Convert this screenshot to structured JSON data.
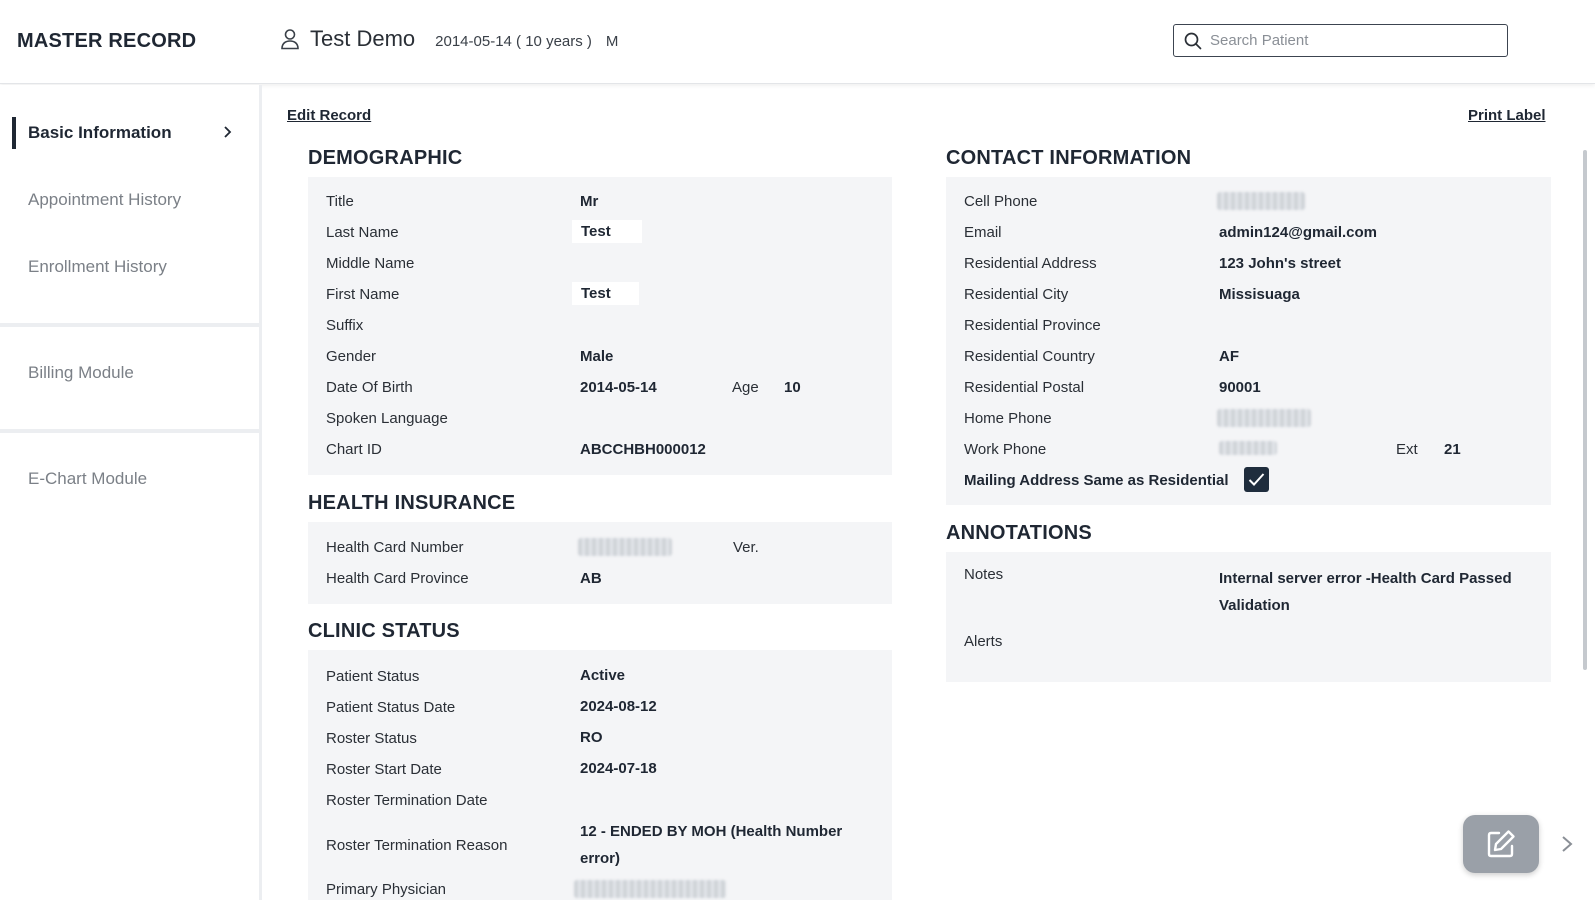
{
  "header": {
    "app_title": "MASTER RECORD",
    "patient_name": "Test Demo",
    "patient_dob": "2014-05-14 ( 10 years )",
    "patient_sex": "M",
    "search_placeholder": "Search Patient"
  },
  "sidebar": {
    "items": [
      {
        "label": "Basic Information",
        "active": true
      },
      {
        "label": "Appointment History",
        "active": false
      },
      {
        "label": "Enrollment History",
        "active": false
      },
      {
        "label": "Billing Module",
        "active": false
      },
      {
        "label": "E-Chart Module",
        "active": false
      }
    ]
  },
  "actions": {
    "edit_record": "Edit Record",
    "print_label": "Print Label"
  },
  "demographic": {
    "title": "DEMOGRAPHIC",
    "labels": {
      "title": "Title",
      "last_name": "Last Name",
      "middle_name": "Middle Name",
      "first_name": "First Name",
      "suffix": "Suffix",
      "gender": "Gender",
      "dob": "Date Of Birth",
      "age": "Age",
      "spoken_language": "Spoken Language",
      "chart_id": "Chart ID"
    },
    "values": {
      "title": "Mr",
      "last_name": "Test",
      "middle_name": "",
      "first_name": "Test",
      "suffix": "",
      "gender": "Male",
      "dob": "2014-05-14",
      "age": "10",
      "spoken_language": "",
      "chart_id": "ABCCHBH000012"
    }
  },
  "health_insurance": {
    "title": "HEALTH INSURANCE",
    "labels": {
      "card_number": "Health Card Number",
      "version": "Ver.",
      "province": "Health Card Province"
    },
    "values": {
      "province": "AB"
    }
  },
  "clinic_status": {
    "title": "CLINIC STATUS",
    "labels": {
      "patient_status": "Patient Status",
      "patient_status_date": "Patient Status Date",
      "roster_status": "Roster Status",
      "roster_start": "Roster Start Date",
      "roster_term_date": "Roster Termination Date",
      "roster_term_reason": "Roster Termination Reason",
      "primary_physician": "Primary Physician"
    },
    "values": {
      "patient_status": "Active",
      "patient_status_date": "2024-08-12",
      "roster_status": "RO",
      "roster_start": "2024-07-18",
      "roster_term_date": "",
      "roster_term_reason_l1": "12 - ENDED BY MOH (Health Number",
      "roster_term_reason_l2": "error)"
    }
  },
  "contact": {
    "title": "CONTACT INFORMATION",
    "labels": {
      "cell": "Cell Phone",
      "email": "Email",
      "res_address": "Residential Address",
      "res_city": "Residential City",
      "res_province": "Residential Province",
      "res_country": "Residential Country",
      "res_postal": "Residential Postal",
      "home_phone": "Home Phone",
      "work_phone": "Work Phone",
      "ext": "Ext",
      "mailing_same": "Mailing Address Same as Residential"
    },
    "values": {
      "email": "admin124@gmail.com",
      "res_address": "123 John's street",
      "res_city": "Missisuaga",
      "res_province": "",
      "res_country": "AF",
      "res_postal": "90001",
      "ext": "21",
      "mailing_same": true
    }
  },
  "annotations": {
    "title": "ANNOTATIONS",
    "labels": {
      "notes": "Notes",
      "alerts": "Alerts"
    },
    "values": {
      "notes_l1": "Internal server error -Health Card Passed",
      "notes_l2": "Validation",
      "alerts": ""
    }
  },
  "icons": {
    "person": "person-icon",
    "search": "search-icon",
    "chevron": "chevron-right-icon",
    "edit": "edit-icon",
    "check": "check-icon"
  },
  "colors": {
    "primary": "#1f2733",
    "card_bg": "#f4f5f7",
    "fab": "#9aa0a8",
    "muted": "#7b8087"
  }
}
